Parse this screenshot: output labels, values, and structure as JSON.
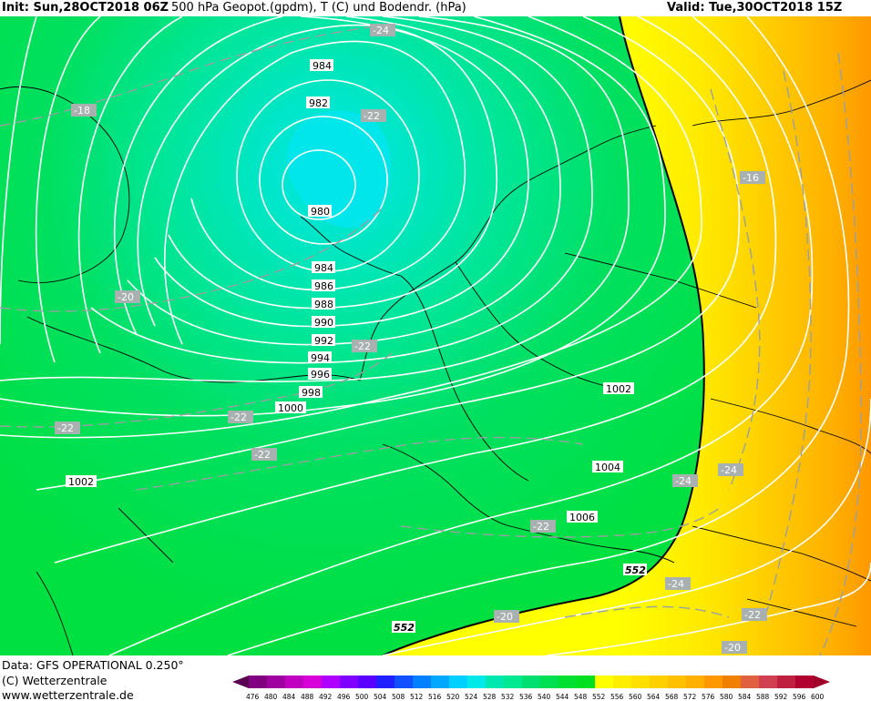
{
  "header": {
    "init": "Init: Sun,28OCT2018 06Z",
    "title": "500 hPa Geopot.(gpdm), T (C) und Bodendr. (hPa)",
    "valid": "Valid: Tue,30OCT2018 15Z"
  },
  "footer": {
    "data_source": "Data: GFS OPERATIONAL 0.250°",
    "copyright": "(C) Wetterzentrale",
    "url": "www.wetterzentrale.de"
  },
  "pressure_labels": [
    {
      "text": "984"
    },
    {
      "text": "982"
    },
    {
      "text": "980"
    },
    {
      "text": "984"
    },
    {
      "text": "986"
    },
    {
      "text": "988"
    },
    {
      "text": "990"
    },
    {
      "text": "992"
    },
    {
      "text": "994"
    },
    {
      "text": "996"
    },
    {
      "text": "998"
    },
    {
      "text": "1000"
    },
    {
      "text": "1002"
    },
    {
      "text": "1002"
    },
    {
      "text": "1004"
    },
    {
      "text": "1006"
    }
  ],
  "temperature_labels": [
    {
      "text": "-24"
    },
    {
      "text": "-18"
    },
    {
      "text": "-22"
    },
    {
      "text": "-20"
    },
    {
      "text": "-22"
    },
    {
      "text": "-22"
    },
    {
      "text": "-22"
    },
    {
      "text": "-22"
    },
    {
      "text": "-16"
    },
    {
      "text": "-24"
    },
    {
      "text": "-24"
    },
    {
      "text": "-22"
    },
    {
      "text": "-24"
    },
    {
      "text": "-20"
    },
    {
      "text": "-22"
    },
    {
      "text": "-20"
    }
  ],
  "geopotential_labels": [
    {
      "text": "552"
    },
    {
      "text": "552"
    }
  ],
  "colorbar": {
    "ticks": [
      "476",
      "480",
      "484",
      "488",
      "492",
      "496",
      "500",
      "504",
      "508",
      "512",
      "516",
      "520",
      "524",
      "528",
      "532",
      "536",
      "540",
      "544",
      "548",
      "552",
      "556",
      "560",
      "564",
      "568",
      "572",
      "576",
      "580",
      "584",
      "588",
      "592",
      "596",
      "600"
    ],
    "colors": [
      "#5a0050",
      "#800080",
      "#a000a0",
      "#c000c0",
      "#d800d8",
      "#b000ff",
      "#8000ff",
      "#5a00ff",
      "#2020ff",
      "#1050ff",
      "#0080ff",
      "#00a8ff",
      "#00d0ff",
      "#00e8e8",
      "#00e8b0",
      "#00e890",
      "#00e070",
      "#00e050",
      "#00e030",
      "#00e020",
      "#ffff00",
      "#ffee00",
      "#ffe000",
      "#ffd000",
      "#ffc000",
      "#ffb000",
      "#ff9800",
      "#f08000",
      "#e06040",
      "#d04050",
      "#c02040",
      "#b00030",
      "#a00028"
    ],
    "scheme_colors": {
      "cyan_core": "#00e6e6",
      "teal": "#00e0a0",
      "green": "#00e040",
      "yellow": "#ffff00",
      "orange": "#ffa000"
    }
  }
}
